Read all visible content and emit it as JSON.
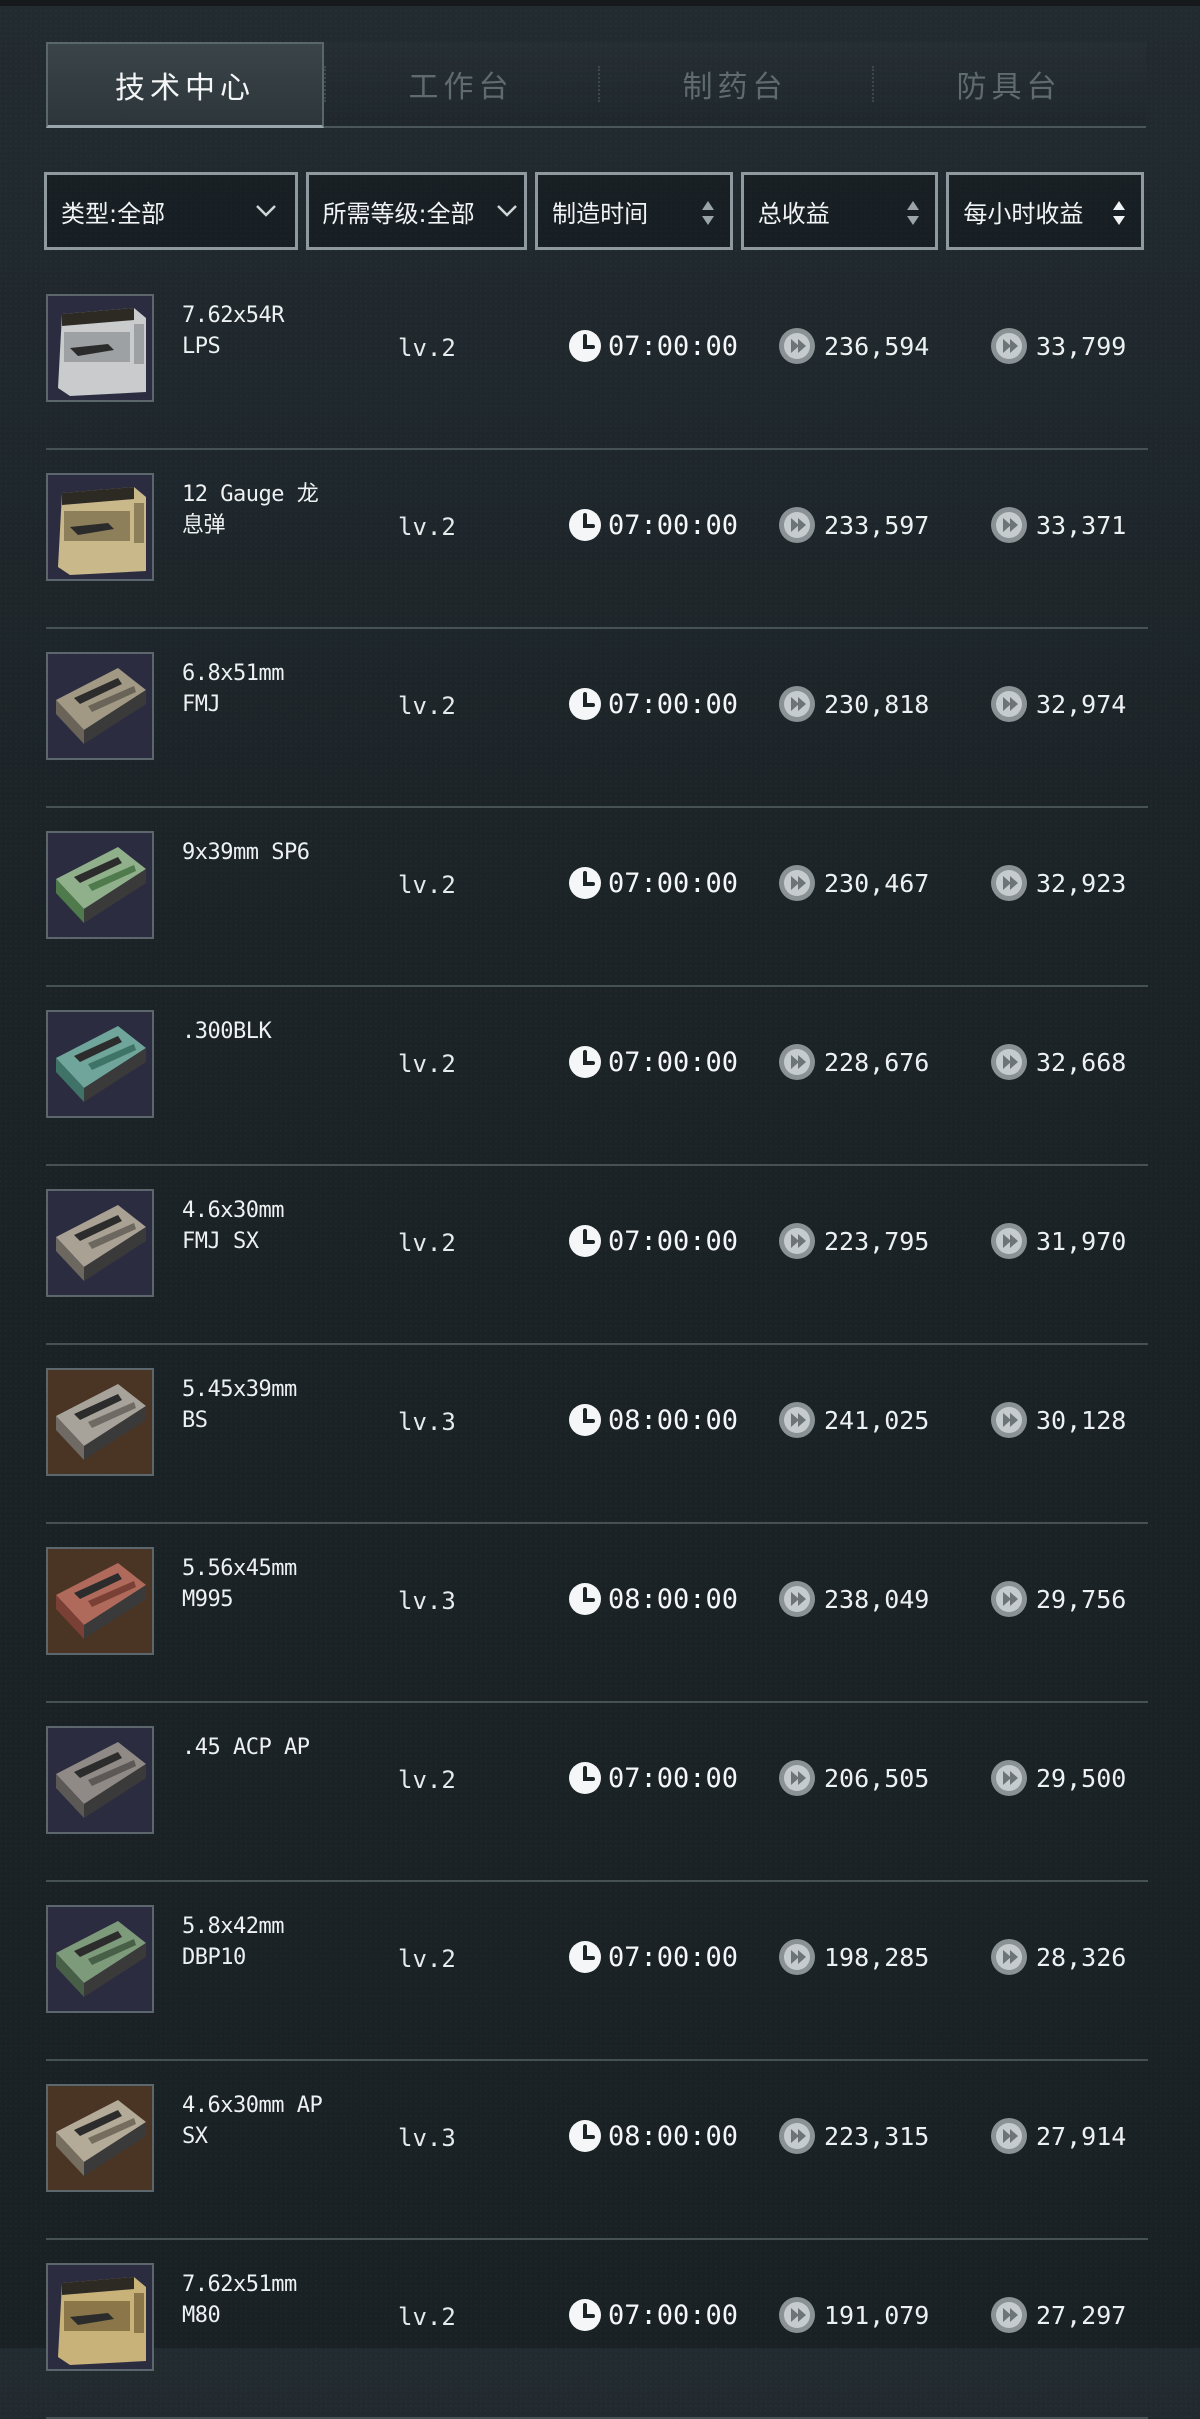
{
  "tabs": [
    {
      "label": "技术中心",
      "active": true
    },
    {
      "label": "工作台",
      "active": false
    },
    {
      "label": "制药台",
      "active": false
    },
    {
      "label": "防具台",
      "active": false
    }
  ],
  "filters": {
    "type": "类型:全部",
    "level": "所需等级:全部",
    "craft_time": "制造时间",
    "total_profit": "总收益",
    "hourly_profit": "每小时收益"
  },
  "items": [
    {
      "name": "7.62x54R LPS",
      "level": "lv.2",
      "time": "07:00:00",
      "total": "236,594",
      "hourly": "33,799",
      "thumb_bg": "#2b2c40",
      "box": "#c9cbcc",
      "stripe": "#9da1a3",
      "icon": "large-box-icon"
    },
    {
      "name": "12 Gauge 龙息弹",
      "level": "lv.2",
      "time": "07:00:00",
      "total": "233,597",
      "hourly": "33,371",
      "thumb_bg": "#2b2c40",
      "box": "#c9b88a",
      "stripe": "#8d7f59",
      "icon": "large-box-icon"
    },
    {
      "name": "6.8x51mm FMJ",
      "level": "lv.2",
      "time": "07:00:00",
      "total": "230,818",
      "hourly": "32,974",
      "thumb_bg": "#2b2c40",
      "box": "#a29985",
      "stripe": "#6a6458",
      "icon": "ammo-box-icon"
    },
    {
      "name": "9x39mm SP6",
      "level": "lv.2",
      "time": "07:00:00",
      "total": "230,467",
      "hourly": "32,923",
      "thumb_bg": "#2b2c40",
      "box": "#8fb08a",
      "stripe": "#4e7a4c",
      "icon": "ammo-box-icon"
    },
    {
      "name": ".300BLK",
      "level": "lv.2",
      "time": "07:00:00",
      "total": "228,676",
      "hourly": "32,668",
      "thumb_bg": "#2b2c40",
      "box": "#6fa59a",
      "stripe": "#3f7368",
      "icon": "ammo-box-icon"
    },
    {
      "name": "4.6x30mm FMJ SX",
      "level": "lv.2",
      "time": "07:00:00",
      "total": "223,795",
      "hourly": "31,970",
      "thumb_bg": "#2b2c40",
      "box": "#a9a294",
      "stripe": "#6d685f",
      "icon": "ammo-box-icon"
    },
    {
      "name": "5.45x39mm BS",
      "level": "lv.3",
      "time": "08:00:00",
      "total": "241,025",
      "hourly": "30,128",
      "thumb_bg": "#4a3424",
      "box": "#a8a39a",
      "stripe": "#6f6b64",
      "icon": "ammo-box-icon"
    },
    {
      "name": "5.56x45mm M995",
      "level": "lv.3",
      "time": "08:00:00",
      "total": "238,049",
      "hourly": "29,756",
      "thumb_bg": "#4a3424",
      "box": "#b06a5c",
      "stripe": "#7a4036",
      "icon": "ammo-box-icon"
    },
    {
      "name": ".45 ACP AP",
      "level": "lv.2",
      "time": "07:00:00",
      "total": "206,505",
      "hourly": "29,500",
      "thumb_bg": "#2b2c40",
      "box": "#8f8a86",
      "stripe": "#5c5855",
      "icon": "ammo-box-icon"
    },
    {
      "name": "5.8x42mm DBP10",
      "level": "lv.2",
      "time": "07:00:00",
      "total": "198,285",
      "hourly": "28,326",
      "thumb_bg": "#2b2c40",
      "box": "#7d9a7a",
      "stripe": "#485f47",
      "icon": "ammo-box-icon"
    },
    {
      "name": "4.6x30mm AP SX",
      "level": "lv.3",
      "time": "08:00:00",
      "total": "223,315",
      "hourly": "27,914",
      "thumb_bg": "#4a3424",
      "box": "#b3ab98",
      "stripe": "#756e5f",
      "icon": "ammo-box-icon"
    },
    {
      "name": "7.62x51mm M80",
      "level": "lv.2",
      "time": "07:00:00",
      "total": "191,079",
      "hourly": "27,297",
      "thumb_bg": "#2b2c40",
      "box": "#c9b27a",
      "stripe": "#8a7648",
      "icon": "large-box-icon"
    }
  ]
}
